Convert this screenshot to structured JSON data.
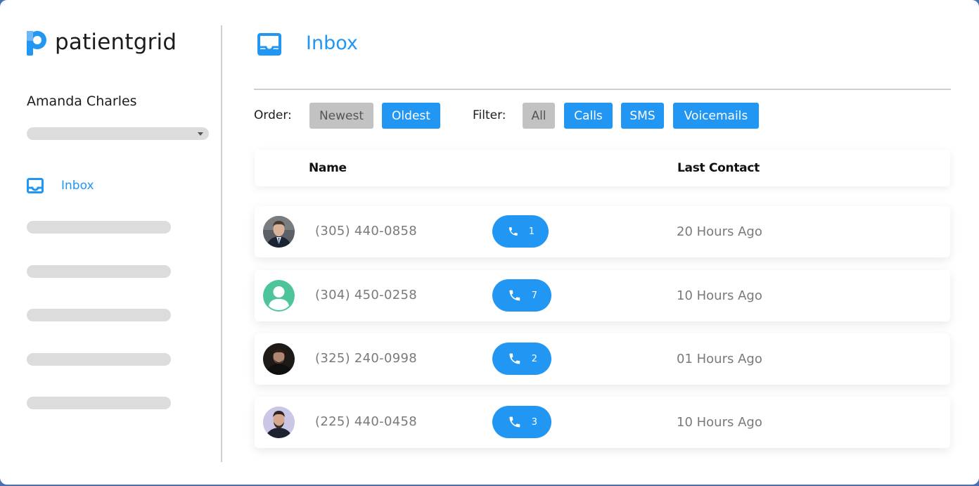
{
  "brand": {
    "name": "patientgrid",
    "color": "#2196f3"
  },
  "user": {
    "name": "Amanda Charles"
  },
  "sidebar": {
    "items": [
      {
        "label": "Inbox",
        "icon": "inbox-icon",
        "active": true
      }
    ]
  },
  "page": {
    "title": "Inbox",
    "icon": "inbox-icon"
  },
  "toolbar": {
    "order_label": "Order:",
    "order_options": [
      {
        "label": "Newest",
        "selected": false
      },
      {
        "label": "Oldest",
        "selected": true
      }
    ],
    "filter_label": "Filter:",
    "filter_options": [
      {
        "label": "All",
        "selected": false
      },
      {
        "label": "Calls",
        "selected": true
      },
      {
        "label": "SMS",
        "selected": true
      },
      {
        "label": "Voicemails",
        "selected": true
      }
    ]
  },
  "table": {
    "columns": [
      "Name",
      "Last Contact"
    ],
    "rows": [
      {
        "phone": "(305) 440-0858",
        "calls": "1",
        "last_contact": "20 Hours Ago",
        "avatar": "photo-man-suit"
      },
      {
        "phone": "(304) 450-0258",
        "calls": "7",
        "last_contact": "10 Hours Ago",
        "avatar": "default-user-icon"
      },
      {
        "phone": "(325) 240-0998",
        "calls": "2",
        "last_contact": "01 Hours Ago",
        "avatar": "photo-man-dark"
      },
      {
        "phone": "(225) 440-0458",
        "calls": "3",
        "last_contact": "10 Hours Ago",
        "avatar": "photo-man-beard"
      }
    ]
  }
}
